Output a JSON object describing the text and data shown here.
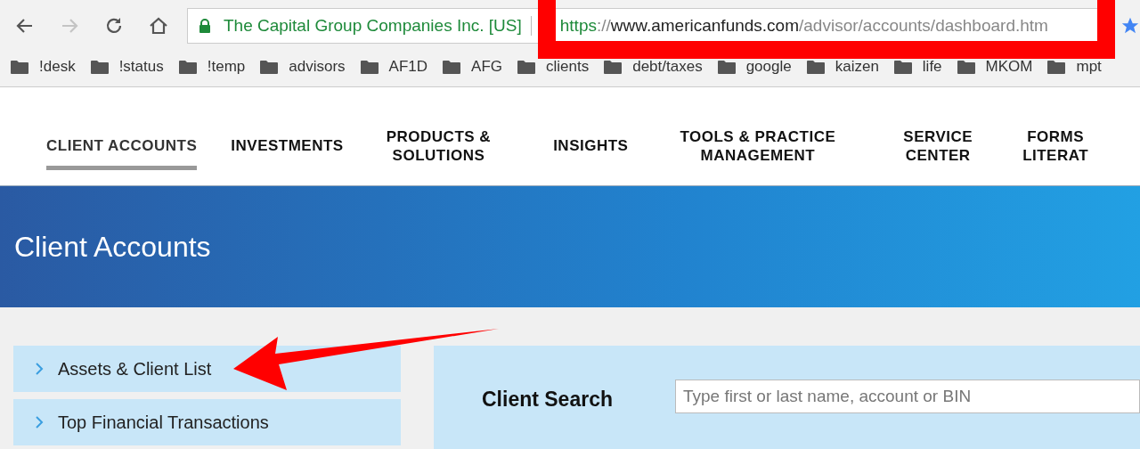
{
  "browser": {
    "address": {
      "secure_label": "The Capital Group Companies Inc. [US]",
      "scheme": "https",
      "scheme_sep": "://",
      "host": "www.americanfunds.com",
      "path": "/advisor/accounts/dashboard.htm"
    },
    "forward_disabled": true,
    "bookmarks": [
      {
        "label": "!desk"
      },
      {
        "label": "!status"
      },
      {
        "label": "!temp"
      },
      {
        "label": "advisors"
      },
      {
        "label": "AF1D"
      },
      {
        "label": "AFG"
      },
      {
        "label": "clients"
      },
      {
        "label": "debt/taxes"
      },
      {
        "label": "google"
      },
      {
        "label": "kaizen"
      },
      {
        "label": "life"
      },
      {
        "label": "MKOM"
      },
      {
        "label": "mpt"
      }
    ]
  },
  "nav": {
    "items": [
      {
        "label": "CLIENT ACCOUNTS",
        "selected": true
      },
      {
        "label": "INVESTMENTS",
        "selected": false
      },
      {
        "label": "PRODUCTS &\nSOLUTIONS",
        "selected": false
      },
      {
        "label": "INSIGHTS",
        "selected": false
      },
      {
        "label": "TOOLS & PRACTICE\nMANAGEMENT",
        "selected": false
      },
      {
        "label": "SERVICE\nCENTER",
        "selected": false
      },
      {
        "label": "FORMS\nLITERAT",
        "selected": false
      }
    ]
  },
  "banner": {
    "title": "Client Accounts"
  },
  "sidebar": {
    "items": [
      {
        "label": "Assets & Client List",
        "expanded": false
      },
      {
        "label": "Top Financial Transactions",
        "expanded": false
      }
    ]
  },
  "client_search": {
    "title": "Client Search",
    "placeholder": "Type first or last name, account or BIN"
  }
}
